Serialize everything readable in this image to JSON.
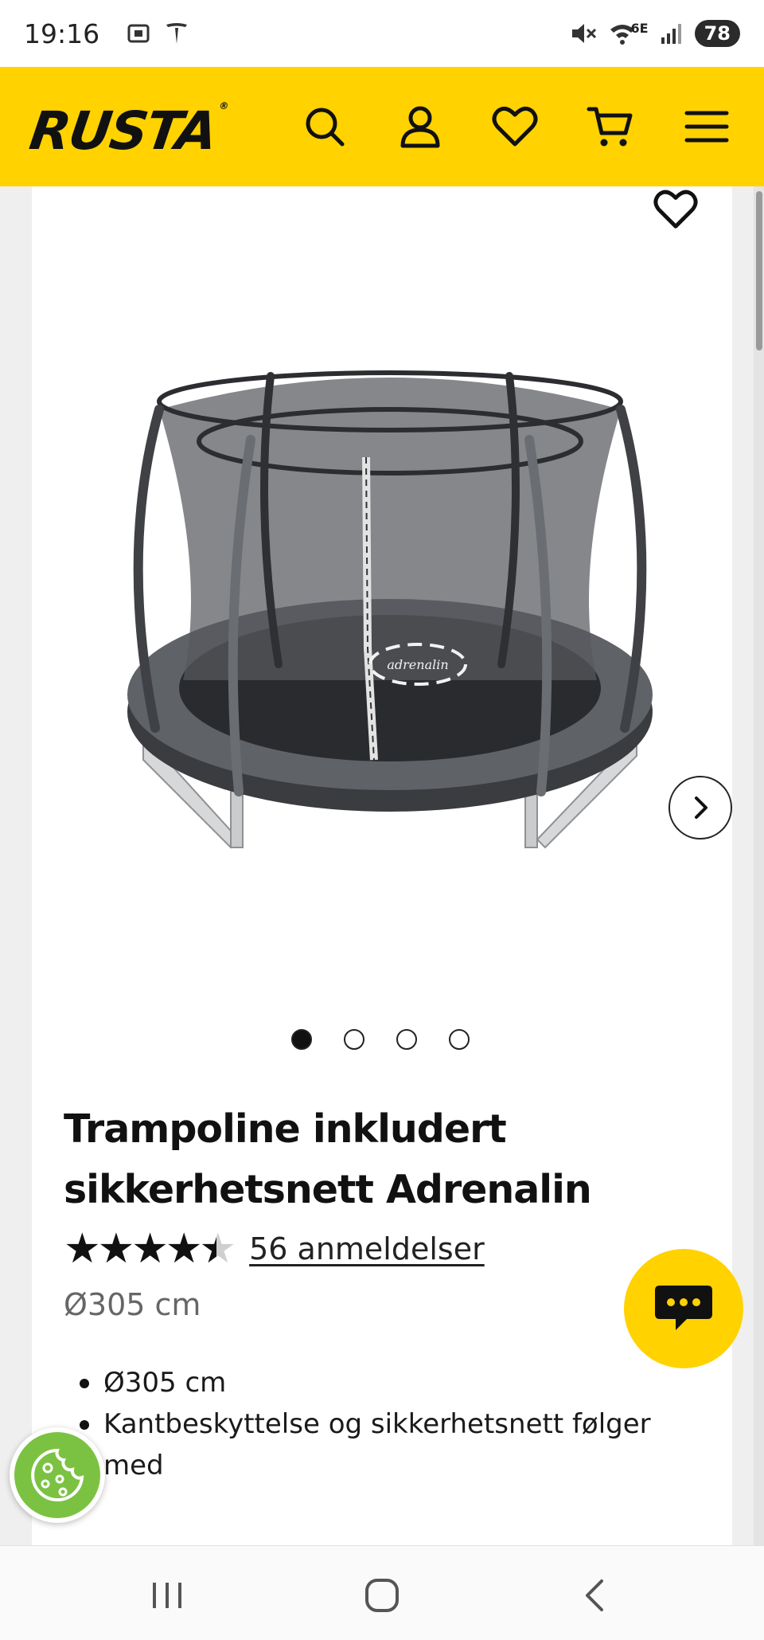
{
  "status_bar": {
    "time": "19:16",
    "network_label": "6E",
    "battery": "78"
  },
  "header": {
    "logo": "RUSTA",
    "icons": [
      "search-icon",
      "user-icon",
      "heart-icon",
      "cart-icon",
      "menu-icon"
    ],
    "brand_color": "#ffd200"
  },
  "product": {
    "image_alt": "Trampoline inkludert sikkerhetsnett Adrenalin",
    "image_text": "adrenalin",
    "carousel": {
      "total": 4,
      "active_index": 0
    },
    "title": "Trampoline inkludert sikkerhetsnett Adrenalin",
    "rating": {
      "value": 4.5,
      "max": 5,
      "stars_display": "★★★★★"
    },
    "reviews_link": "56 anmeldelser",
    "size": "Ø305 cm",
    "bullets": [
      "Ø305 cm",
      "Kantbeskyttelse og sikkerhetsnett følger med"
    ]
  },
  "floating": {
    "chat_icon": "chat-bubble-icon",
    "cookie_icon": "cookie-icon"
  },
  "nav_bar": {
    "icons": [
      "recent-apps-icon",
      "home-icon",
      "back-icon"
    ]
  }
}
